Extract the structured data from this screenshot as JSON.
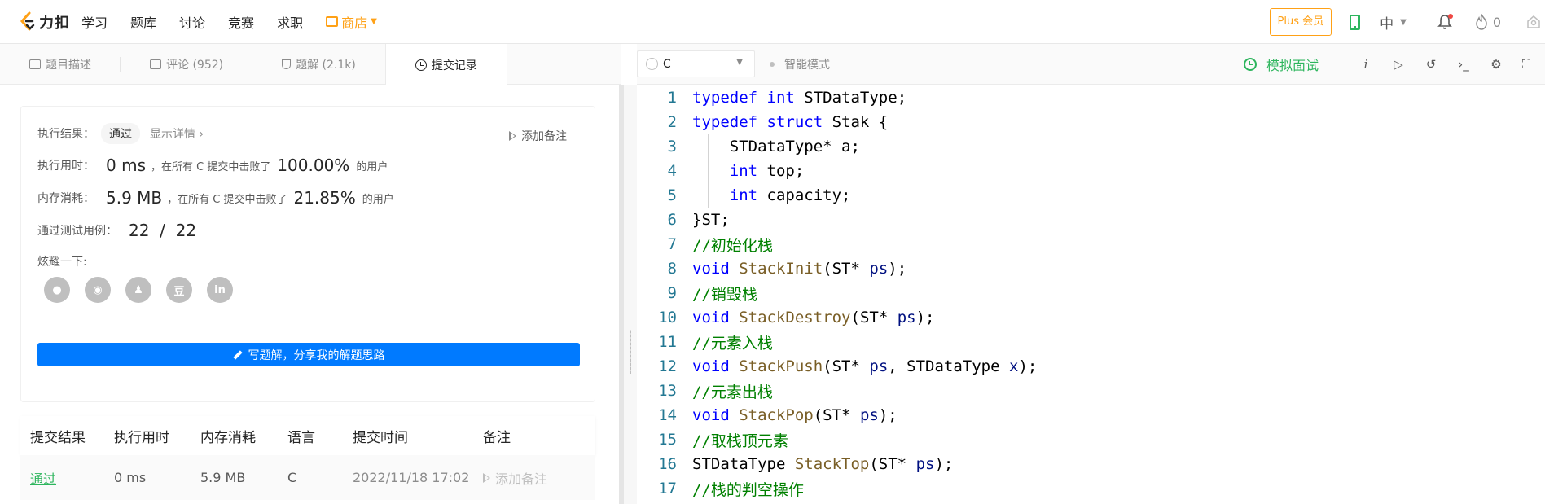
{
  "topnav": {
    "logo_text": "力扣",
    "items": [
      {
        "label": "学习"
      },
      {
        "label": "题库"
      },
      {
        "label": "讨论"
      },
      {
        "label": "竞赛"
      },
      {
        "label": "求职"
      }
    ],
    "shop_label": "商店",
    "plus_label": "Plus 会员",
    "lang_label": "中",
    "points": "0",
    "colors": {
      "accent": "#ffa116",
      "green": "#2db55d"
    }
  },
  "left_tabs": [
    {
      "label": "题目描述",
      "icon": "description-icon"
    },
    {
      "label": "评论 (952)",
      "icon": "comment-icon"
    },
    {
      "label": "题解 (2.1k)",
      "icon": "flask-icon"
    },
    {
      "label": "提交记录",
      "icon": "clock-icon",
      "active": true
    }
  ],
  "result": {
    "exec_result_label": "执行结果：",
    "exec_result_value": "通过",
    "show_details": "显示详情 ›",
    "add_note": "添加备注",
    "runtime_label": "执行用时：",
    "runtime_value": "0 ms",
    "runtime_text": "，在所有 C 提交中击败了",
    "runtime_pct": "100.00%",
    "runtime_suffix": "的用户",
    "memory_label": "内存消耗：",
    "memory_value": "5.9 MB",
    "memory_text": "，在所有 C 提交中击败了",
    "memory_pct": "21.85%",
    "memory_suffix": "的用户",
    "tests_label": "通过测试用例：",
    "tests_value": "22  /  22",
    "share_label": "炫耀一下:",
    "share_icons": [
      {
        "name": "wechat-icon",
        "glyph": "●"
      },
      {
        "name": "weibo-icon",
        "glyph": "◉"
      },
      {
        "name": "qq-icon",
        "glyph": "♟"
      },
      {
        "name": "douban-icon",
        "glyph": "豆"
      },
      {
        "name": "linkedin-icon",
        "glyph": "in"
      }
    ],
    "write_button": "写题解，分享我的解题思路"
  },
  "submissions": {
    "headers": [
      "提交结果",
      "执行用时",
      "内存消耗",
      "语言",
      "提交时间",
      "备注"
    ],
    "rows": [
      {
        "result": "通过",
        "runtime": "0 ms",
        "memory": "5.9 MB",
        "lang": "C",
        "time": "2022/11/18 17:02",
        "note": "添加备注"
      }
    ]
  },
  "editor_toolbar": {
    "language": "C",
    "smart_mode": "智能模式",
    "mock_interview": "模拟面试"
  },
  "code": {
    "line_numbers": [
      "1",
      "2",
      "3",
      "4",
      "5",
      "6",
      "7",
      "8",
      "9",
      "10",
      "11",
      "12",
      "13",
      "14",
      "15",
      "16",
      "17"
    ],
    "lines": [
      [
        {
          "t": "kw",
          "v": "typedef"
        },
        {
          "t": "tx",
          "v": " "
        },
        {
          "t": "kw",
          "v": "int"
        },
        {
          "t": "tx",
          "v": " STDataType;"
        }
      ],
      [
        {
          "t": "kw",
          "v": "typedef"
        },
        {
          "t": "tx",
          "v": " "
        },
        {
          "t": "kw",
          "v": "struct"
        },
        {
          "t": "tx",
          "v": " Stak {"
        }
      ],
      [
        {
          "t": "tx",
          "v": "    STDataType* a;"
        }
      ],
      [
        {
          "t": "tx",
          "v": "    "
        },
        {
          "t": "kw",
          "v": "int"
        },
        {
          "t": "tx",
          "v": " top;"
        }
      ],
      [
        {
          "t": "tx",
          "v": "    "
        },
        {
          "t": "kw",
          "v": "int"
        },
        {
          "t": "tx",
          "v": " capacity;"
        }
      ],
      [
        {
          "t": "tx",
          "v": "}ST;"
        }
      ],
      [
        {
          "t": "cm",
          "v": "//初始化栈"
        }
      ],
      [
        {
          "t": "kw",
          "v": "void"
        },
        {
          "t": "tx",
          "v": " "
        },
        {
          "t": "fn",
          "v": "StackInit"
        },
        {
          "t": "tx",
          "v": "(ST* "
        },
        {
          "t": "pm",
          "v": "ps"
        },
        {
          "t": "tx",
          "v": ");"
        }
      ],
      [
        {
          "t": "cm",
          "v": "//销毁栈"
        }
      ],
      [
        {
          "t": "kw",
          "v": "void"
        },
        {
          "t": "tx",
          "v": " "
        },
        {
          "t": "fn",
          "v": "StackDestroy"
        },
        {
          "t": "tx",
          "v": "(ST* "
        },
        {
          "t": "pm",
          "v": "ps"
        },
        {
          "t": "tx",
          "v": ");"
        }
      ],
      [
        {
          "t": "cm",
          "v": "//元素入栈"
        }
      ],
      [
        {
          "t": "kw",
          "v": "void"
        },
        {
          "t": "tx",
          "v": " "
        },
        {
          "t": "fn",
          "v": "StackPush"
        },
        {
          "t": "tx",
          "v": "(ST* "
        },
        {
          "t": "pm",
          "v": "ps"
        },
        {
          "t": "tx",
          "v": ", STDataType "
        },
        {
          "t": "pm",
          "v": "x"
        },
        {
          "t": "tx",
          "v": ");"
        }
      ],
      [
        {
          "t": "cm",
          "v": "//元素出栈"
        }
      ],
      [
        {
          "t": "kw",
          "v": "void"
        },
        {
          "t": "tx",
          "v": " "
        },
        {
          "t": "fn",
          "v": "StackPop"
        },
        {
          "t": "tx",
          "v": "(ST* "
        },
        {
          "t": "pm",
          "v": "ps"
        },
        {
          "t": "tx",
          "v": ");"
        }
      ],
      [
        {
          "t": "cm",
          "v": "//取栈顶元素"
        }
      ],
      [
        {
          "t": "tx",
          "v": "STDataType "
        },
        {
          "t": "fn",
          "v": "StackTop"
        },
        {
          "t": "tx",
          "v": "(ST* "
        },
        {
          "t": "pm",
          "v": "ps"
        },
        {
          "t": "tx",
          "v": ");"
        }
      ],
      [
        {
          "t": "cm",
          "v": "//栈的判空操作"
        }
      ]
    ]
  }
}
